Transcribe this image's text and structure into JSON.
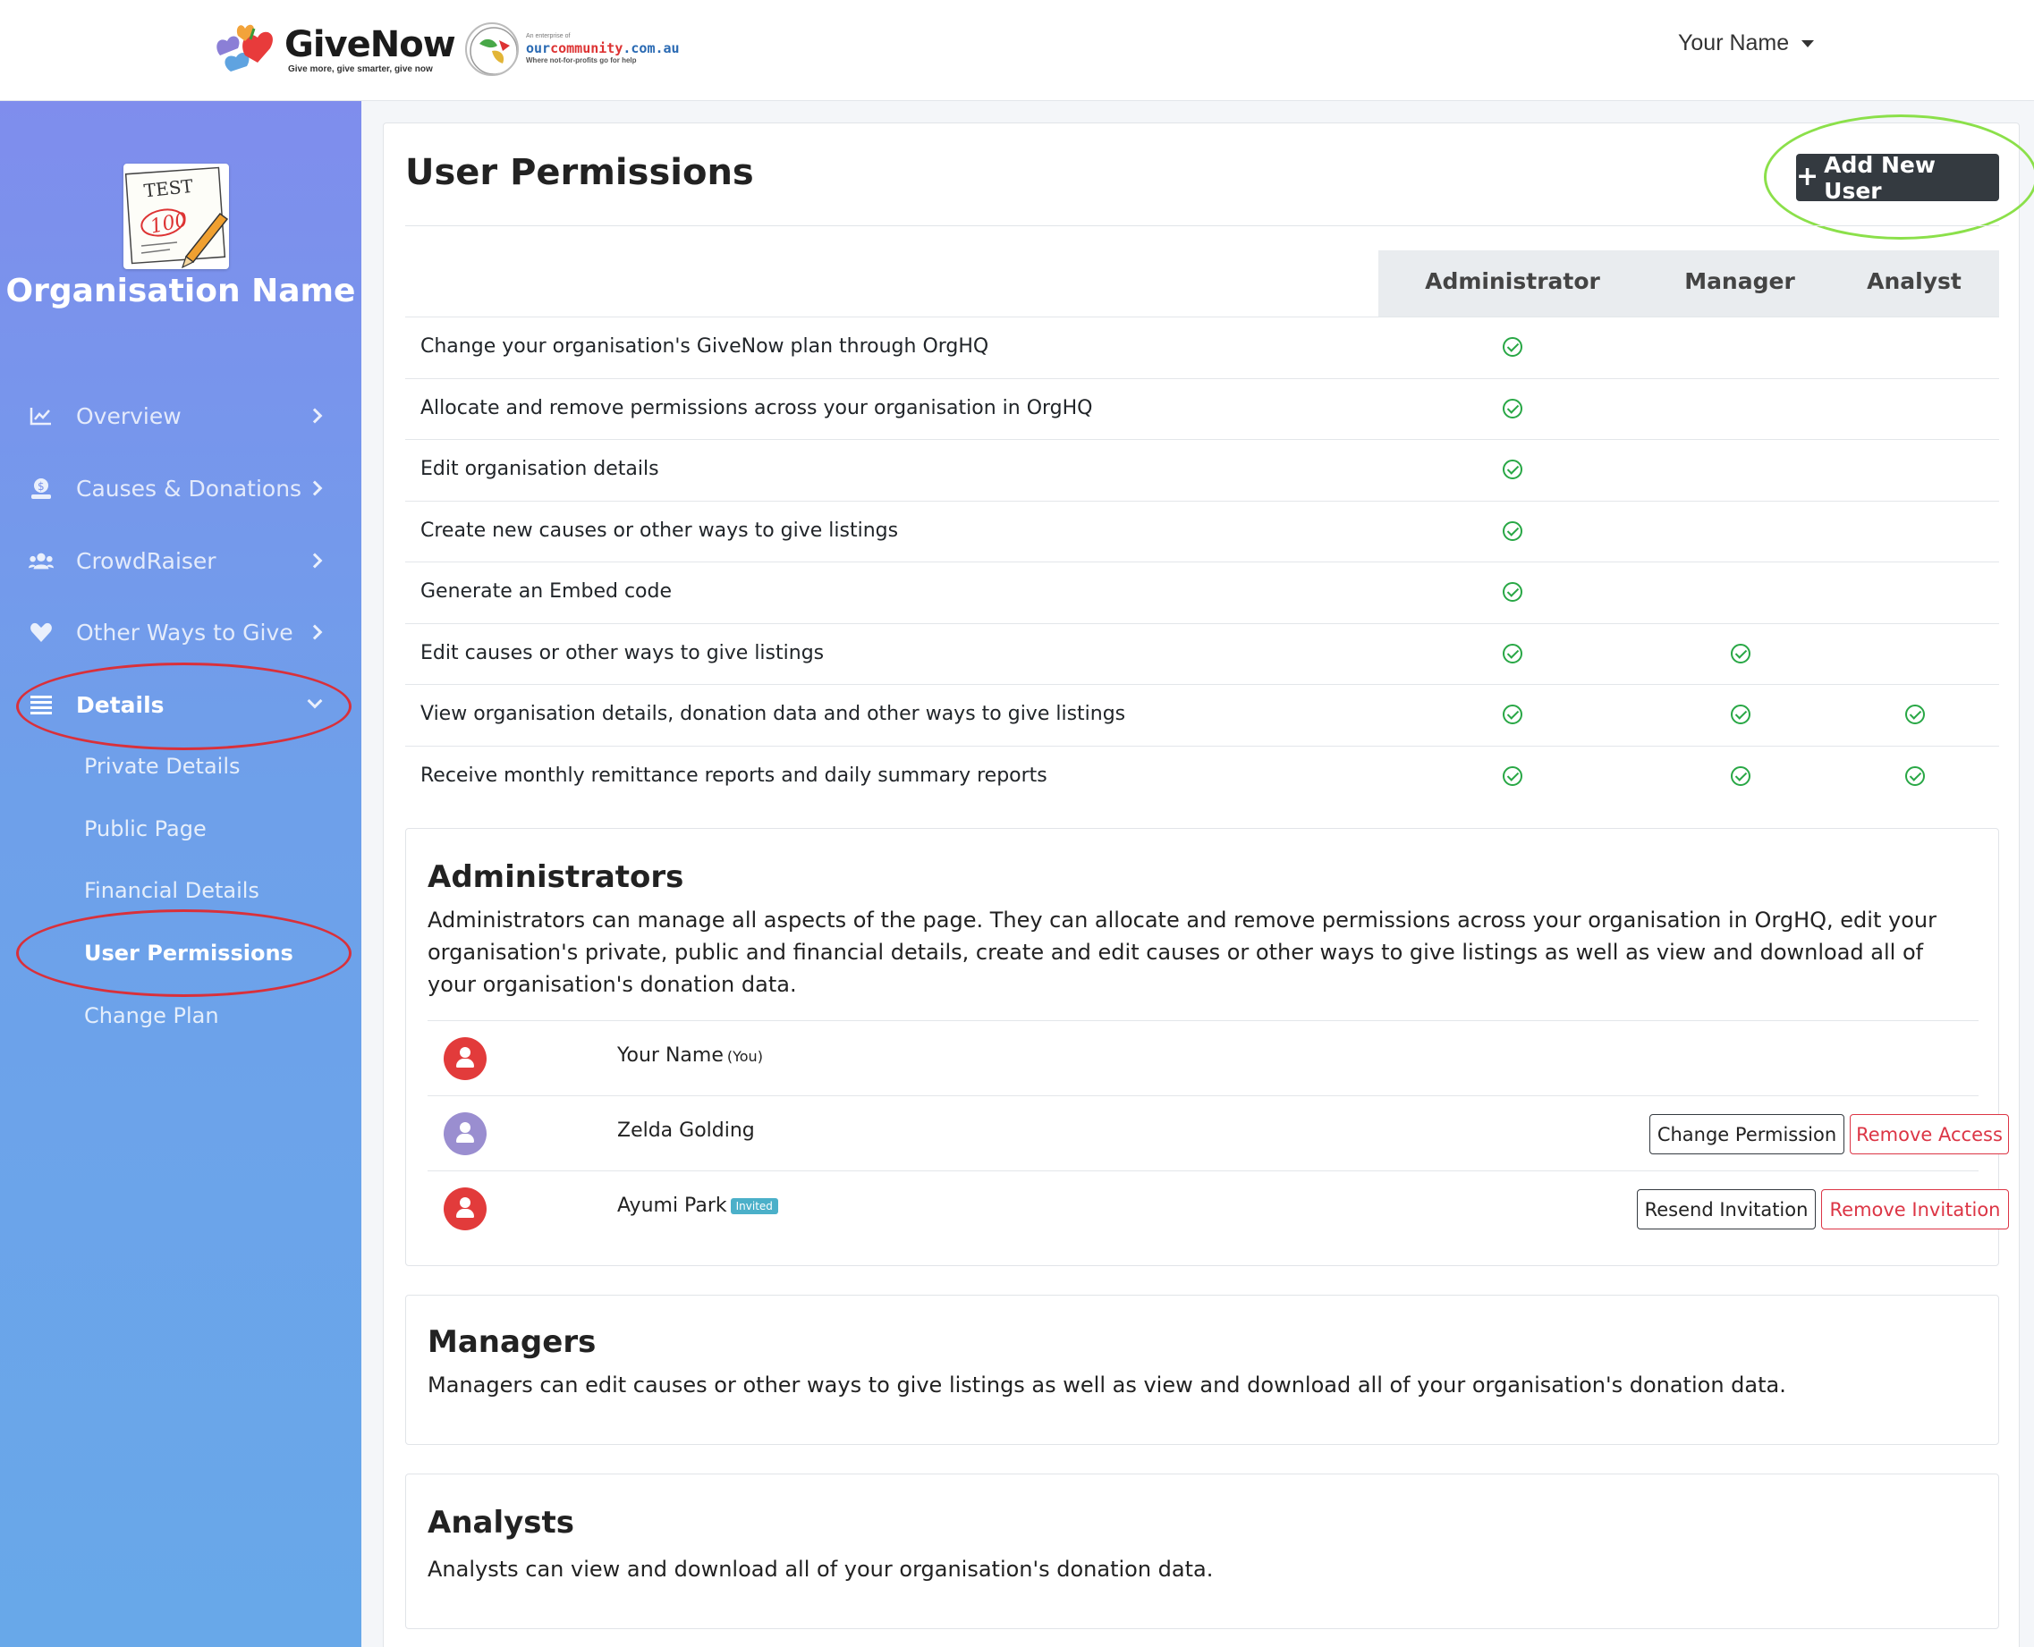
{
  "header": {
    "brand": {
      "name": "GiveNow",
      "tagline": "Give more, give smarter, give now"
    },
    "partner": {
      "small": "An enterprise of",
      "domain_main": "our",
      "domain_accent": "community",
      "domain_tail": ".com.au",
      "slogan": "Where not-for-profits go for help"
    },
    "user_menu": "Your Name"
  },
  "sidebar": {
    "org_logo_text": {
      "top": "TEST",
      "score": "100"
    },
    "org_name": "Organisation Name",
    "nav": [
      {
        "label": "Overview",
        "icon": "chart-line-icon"
      },
      {
        "label": "Causes & Donations",
        "icon": "money-hand-icon"
      },
      {
        "label": "CrowdRaiser",
        "icon": "users-icon"
      },
      {
        "label": "Other Ways to Give",
        "icon": "heart-icon"
      },
      {
        "label": "Details",
        "icon": "list-icon"
      }
    ],
    "sub": [
      {
        "label": "Private Details"
      },
      {
        "label": "Public Page"
      },
      {
        "label": "Financial Details"
      },
      {
        "label": "User Permissions"
      },
      {
        "label": "Change Plan"
      }
    ]
  },
  "main": {
    "title": "User Permissions",
    "add_button": "Add New User",
    "roles_header": [
      "Administrator",
      "Manager",
      "Analyst"
    ],
    "permissions": [
      {
        "label": "Change your organisation's GiveNow plan through OrgHQ",
        "admin": true,
        "manager": false,
        "analyst": false
      },
      {
        "label": "Allocate and remove permissions across your organisation in OrgHQ",
        "admin": true,
        "manager": false,
        "analyst": false
      },
      {
        "label": "Edit organisation details",
        "admin": true,
        "manager": false,
        "analyst": false
      },
      {
        "label": "Create new causes or other ways to give listings",
        "admin": true,
        "manager": false,
        "analyst": false
      },
      {
        "label": "Generate an Embed code",
        "admin": true,
        "manager": false,
        "analyst": false
      },
      {
        "label": "Edit causes or other ways to give listings",
        "admin": true,
        "manager": true,
        "analyst": false
      },
      {
        "label": "View organisation details, donation data and other ways to give listings",
        "admin": true,
        "manager": true,
        "analyst": true
      },
      {
        "label": "Receive monthly remittance reports and daily summary reports",
        "admin": true,
        "manager": true,
        "analyst": true
      }
    ],
    "administrators": {
      "title": "Administrators",
      "desc": "Administrators can manage all aspects of the page. They can allocate and remove permissions across your organisation in OrgHQ, edit your organisation's private, public and financial details, create and edit causes or other ways to give listings as well as view and download all of your organisation's donation data.",
      "users": [
        {
          "name": "Your Name",
          "suffix": "(You)"
        },
        {
          "name": "Zelda Golding",
          "btn1": "Change Permission",
          "btn2": "Remove Access"
        },
        {
          "name": "Ayumi Park",
          "badge": "Invited",
          "btn1": "Resend Invitation",
          "btn2": "Remove Invitation"
        }
      ]
    },
    "managers": {
      "title": "Managers",
      "desc": "Managers can edit causes or other ways to give listings as well as view and download all of your organisation's donation data."
    },
    "analysts": {
      "title": "Analysts",
      "desc": "Analysts can view and download all of your organisation's donation data."
    }
  }
}
